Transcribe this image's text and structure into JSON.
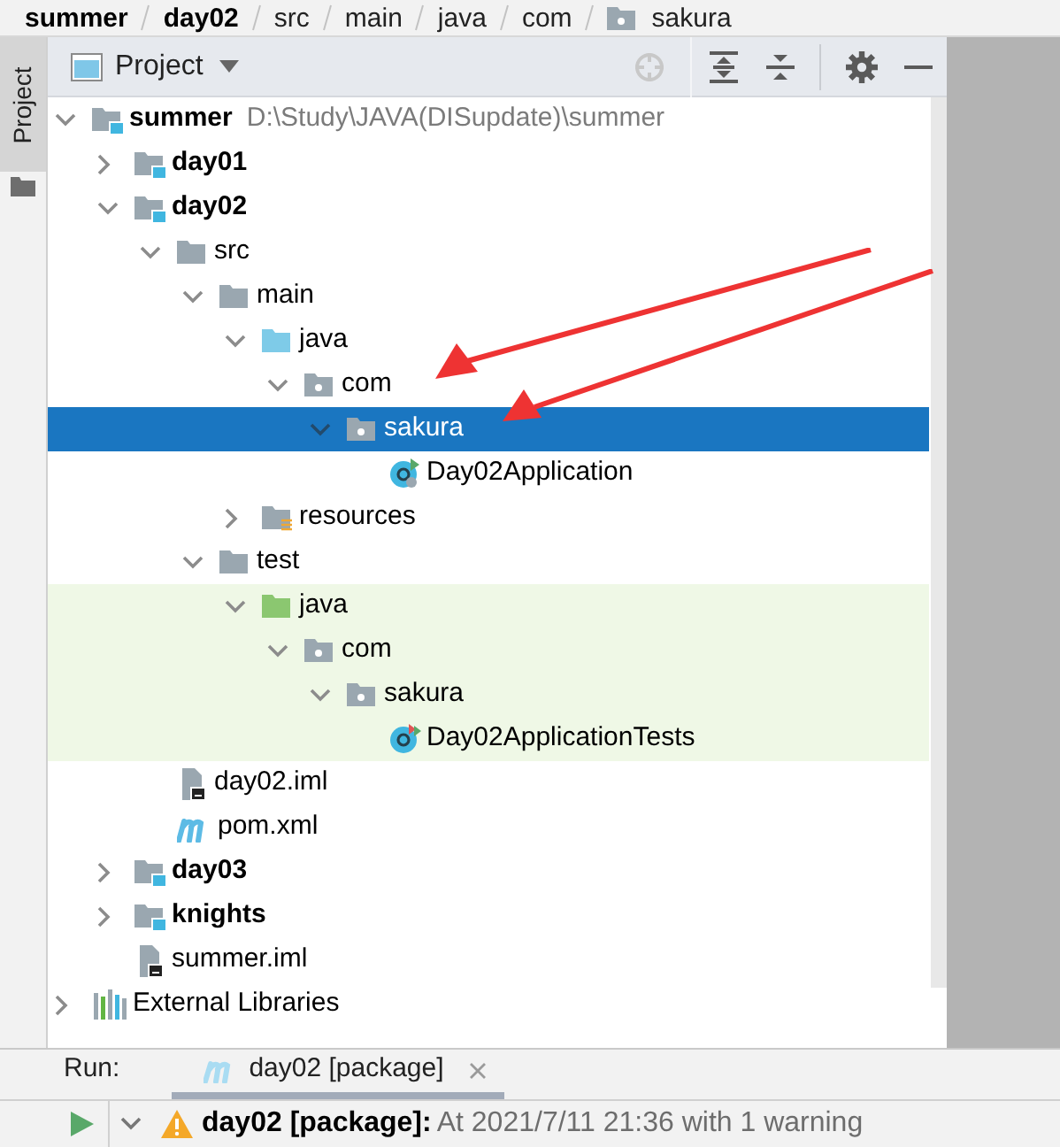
{
  "breadcrumb": [
    {
      "label": "summer",
      "bold": true
    },
    {
      "label": "day02",
      "bold": true
    },
    {
      "label": "src",
      "bold": false
    },
    {
      "label": "main",
      "bold": false
    },
    {
      "label": "java",
      "bold": false
    },
    {
      "label": "com",
      "bold": false
    },
    {
      "label": "sakura",
      "bold": false,
      "kind": "package"
    }
  ],
  "side_tab": {
    "label": "Project",
    "selected": true
  },
  "panel": {
    "title": "Project"
  },
  "tree": [
    {
      "label": "summer",
      "kind": "module",
      "note": "D:\\Study\\JAVA(DISupdate)\\summer",
      "expanded": true,
      "selected": false,
      "children": [
        {
          "label": "day01",
          "kind": "module",
          "expanded": false,
          "selected": false
        },
        {
          "label": "day02",
          "kind": "module",
          "expanded": true,
          "selected": false,
          "children": [
            {
              "label": "src",
              "kind": "folder",
              "expanded": true,
              "selected": false,
              "children": [
                {
                  "label": "main",
                  "kind": "folder",
                  "expanded": true,
                  "selected": false,
                  "children": [
                    {
                      "label": "java",
                      "kind": "source_folder",
                      "expanded": true,
                      "selected": false,
                      "children": [
                        {
                          "label": "com",
                          "kind": "package",
                          "expanded": true,
                          "selected": false,
                          "children": [
                            {
                              "label": "sakura",
                              "kind": "package",
                              "expanded": true,
                              "selected": true,
                              "children": [
                                {
                                  "label": "Day02Application",
                                  "kind": "app_class",
                                  "selected": false
                                }
                              ]
                            }
                          ]
                        }
                      ]
                    },
                    {
                      "label": "resources",
                      "kind": "resource_folder",
                      "expanded": false,
                      "selected": false
                    }
                  ]
                },
                {
                  "label": "test",
                  "kind": "folder",
                  "expanded": true,
                  "selected": false,
                  "children": [
                    {
                      "label": "java",
                      "kind": "test_folder",
                      "expanded": true,
                      "selected": false,
                      "tinted": true,
                      "children": [
                        {
                          "label": "com",
                          "kind": "package",
                          "expanded": true,
                          "selected": false,
                          "tinted": true,
                          "children": [
                            {
                              "label": "sakura",
                              "kind": "package",
                              "expanded": true,
                              "selected": false,
                              "tinted": true,
                              "children": [
                                {
                                  "label": "Day02ApplicationTests",
                                  "kind": "test_class",
                                  "selected": false,
                                  "tinted": true
                                }
                              ]
                            }
                          ]
                        }
                      ]
                    }
                  ]
                }
              ]
            },
            {
              "label": "day02.iml",
              "kind": "iml",
              "selected": false
            },
            {
              "label": "pom.xml",
              "kind": "maven",
              "selected": false
            }
          ]
        },
        {
          "label": "day03",
          "kind": "module",
          "expanded": false,
          "selected": false
        },
        {
          "label": "knights",
          "kind": "module",
          "expanded": false,
          "selected": false
        },
        {
          "label": "summer.iml",
          "kind": "iml",
          "selected": false
        }
      ]
    },
    {
      "label": "External Libraries",
      "kind": "libraries",
      "expanded": false,
      "selected": false
    }
  ],
  "run": {
    "label": "Run:",
    "tabs": [
      {
        "label": "day02 [package]",
        "selected": true
      }
    ],
    "entry": {
      "title": "day02 [package]:",
      "message": "At 2021/7/11 21:36 with 1 warning",
      "expanded": true
    }
  }
}
